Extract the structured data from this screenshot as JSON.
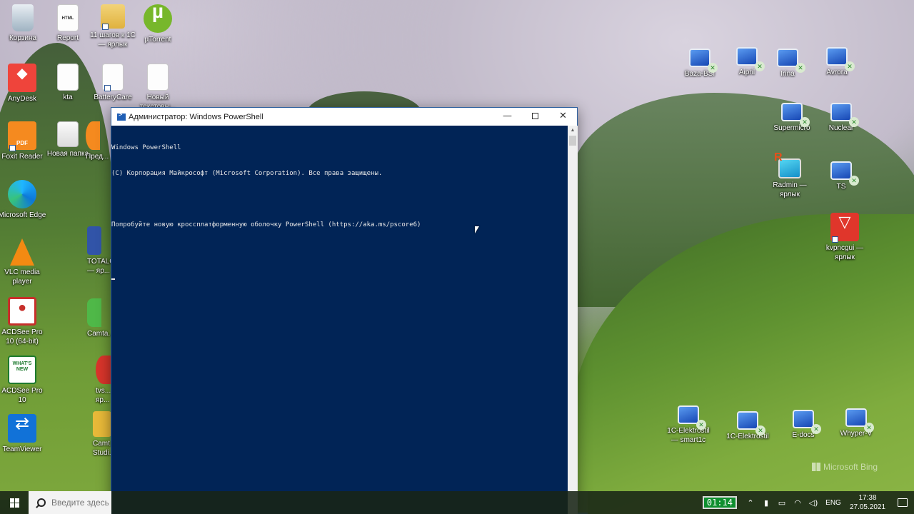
{
  "desktop": {
    "icons": [
      {
        "label": "Корзина",
        "icon": "recycle-bin-icon"
      },
      {
        "label": "Report",
        "icon": "html-file-icon"
      },
      {
        "label": "11 шагов к 1С — ярлык",
        "icon": "folder-icon"
      },
      {
        "label": "µTorrent",
        "icon": "utorrent-icon"
      },
      {
        "label": "AnyDesk",
        "icon": "anydesk-icon"
      },
      {
        "label": "kta",
        "icon": "text-file-icon"
      },
      {
        "label": "BatteryCare",
        "icon": "text-file-icon"
      },
      {
        "label": "Новый текстовы...",
        "icon": "text-file-icon"
      },
      {
        "label": "Foxit Reader",
        "icon": "foxit-reader-icon"
      },
      {
        "label": "Новая папка",
        "icon": "new-folder-icon"
      },
      {
        "label": "Пред...",
        "icon": "partial-icon"
      },
      {
        "label": "Microsoft Edge",
        "icon": "edge-icon"
      },
      {
        "label": "VLC media player",
        "icon": "vlc-icon"
      },
      {
        "label": "TOTALC... — яр...",
        "icon": "total-commander-icon"
      },
      {
        "label": "ACDSee Pro 10 (64-bit)",
        "icon": "acdsee-icon"
      },
      {
        "label": "Camta...",
        "icon": "camtasia-icon"
      },
      {
        "label": "ACDSee Pro 10",
        "icon": "acdsee-whats-new-icon"
      },
      {
        "label": "tvs... яр...",
        "icon": "tvs-icon"
      },
      {
        "label": "TeamViewer",
        "icon": "teamviewer-icon"
      },
      {
        "label": "Camt... Studi...",
        "icon": "camtasia-studio-icon"
      },
      {
        "label": "Baza-BSI",
        "icon": "remote-desktop-icon"
      },
      {
        "label": "Aipril",
        "icon": "remote-desktop-icon"
      },
      {
        "label": "Irina",
        "icon": "remote-desktop-icon"
      },
      {
        "label": "Avrora",
        "icon": "remote-desktop-icon"
      },
      {
        "label": "Supermicro",
        "icon": "remote-desktop-icon"
      },
      {
        "label": "Nuclear",
        "icon": "remote-desktop-icon"
      },
      {
        "label": "Radmin — ярлык",
        "icon": "radmin-icon"
      },
      {
        "label": "TS",
        "icon": "remote-desktop-icon"
      },
      {
        "label": "kvpncgui — ярлык",
        "icon": "kvpn-icon"
      },
      {
        "label": "1C-Elektrostil — smart1c",
        "icon": "remote-desktop-icon"
      },
      {
        "label": "1C-Elektrostil",
        "icon": "remote-desktop-icon"
      },
      {
        "label": "E-docs",
        "icon": "remote-desktop-icon"
      },
      {
        "label": "Whyper-V",
        "icon": "remote-desktop-icon"
      }
    ],
    "watermark": "Microsoft Bing"
  },
  "powershell": {
    "title": "Администратор: Windows PowerShell",
    "minimize_glyph": "—",
    "close_glyph": "✕",
    "lines": [
      "Windows PowerShell",
      "(C) Корпорация Майкрософт (Microsoft Corporation). Все права защищены.",
      "",
      "Попробуйте новую кроссплатформенную оболочку PowerShell (https://aka.ms/pscore6)",
      ""
    ],
    "colors": {
      "console_bg": "#012456",
      "console_fg": "#e8e8e8"
    }
  },
  "taskbar": {
    "search_placeholder": "Введите здесь",
    "timer": "01:14",
    "language": "ENG",
    "time": "17:38",
    "date": "27.05.2021",
    "tray_icons": [
      "chevron-up-icon",
      "microphone-icon",
      "battery-icon",
      "wifi-icon",
      "volume-icon"
    ]
  }
}
